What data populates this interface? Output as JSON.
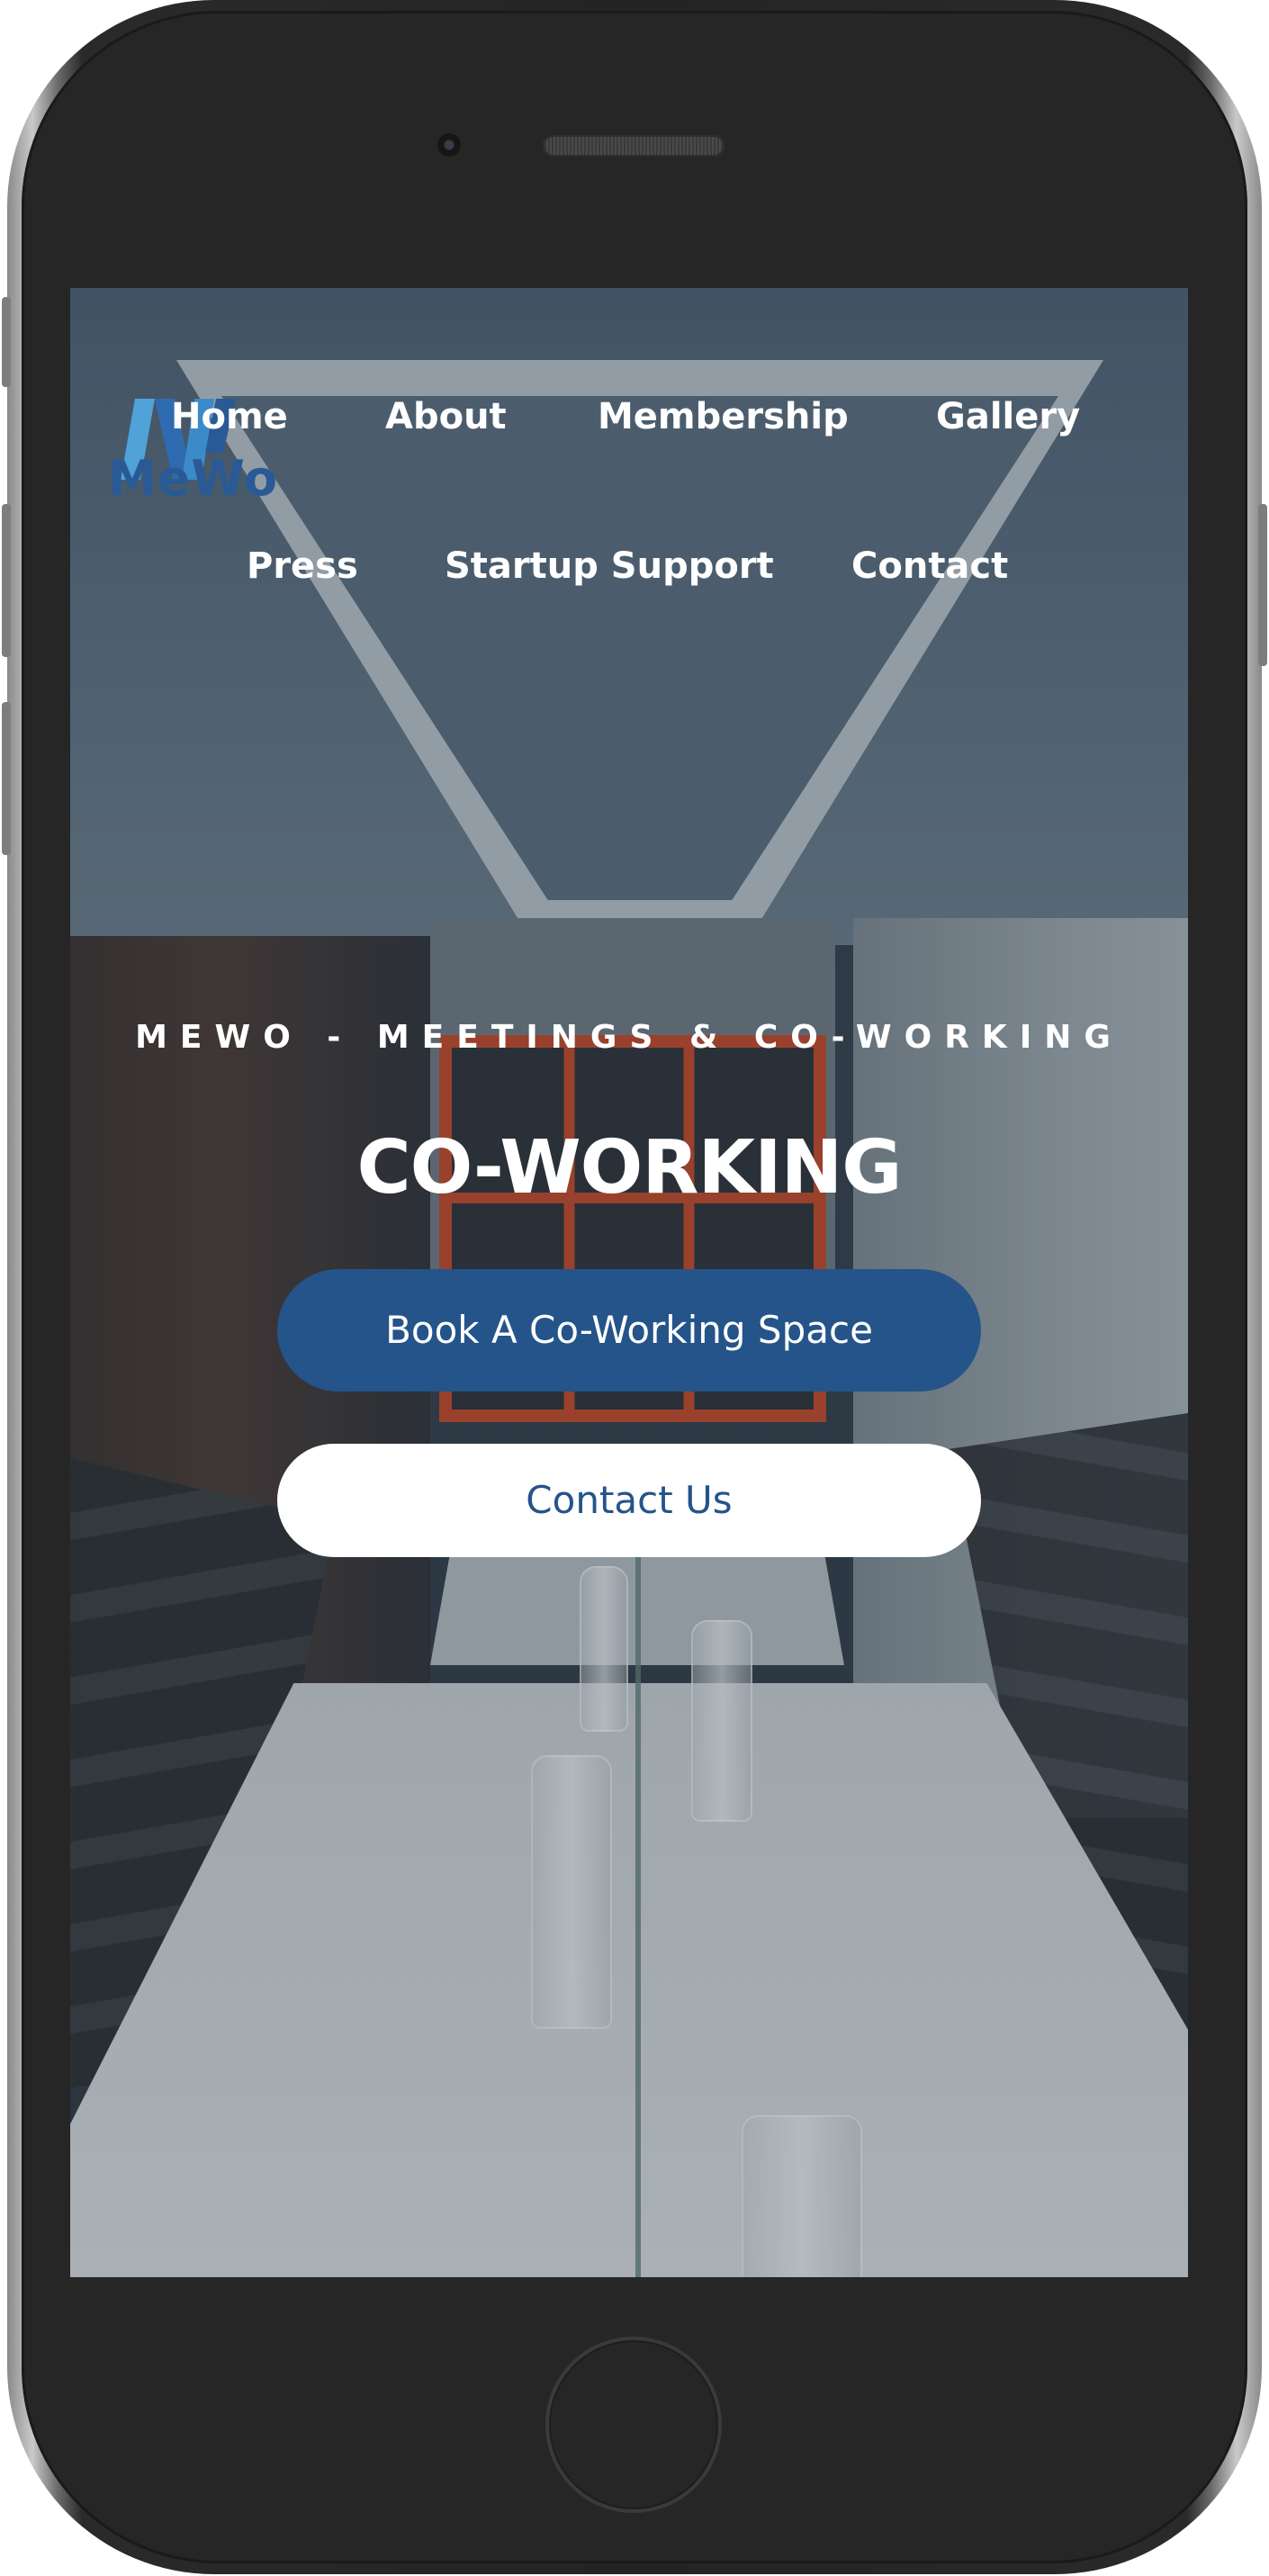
{
  "logo": {
    "mark_icon": "mewo-logo-icon",
    "wordmark": "MeWo",
    "color": "#2a5a96"
  },
  "nav": {
    "items": [
      {
        "label": "Home"
      },
      {
        "label": "About"
      },
      {
        "label": "Membership"
      },
      {
        "label": "Gallery"
      },
      {
        "label": "Press"
      },
      {
        "label": "Startup Support"
      },
      {
        "label": "Contact"
      }
    ]
  },
  "hero": {
    "kicker": "MEWO - MEETINGS & CO-WORKING",
    "title": "CO-WORKING",
    "primary_button": "Book A Co-Working Space",
    "secondary_button": "Contact Us"
  },
  "colors": {
    "brand_blue": "#245489",
    "white": "#ffffff",
    "phone_body": "#262626"
  }
}
